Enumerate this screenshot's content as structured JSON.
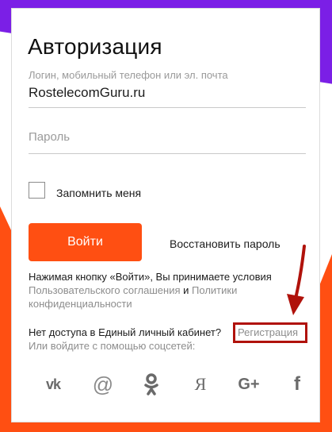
{
  "title": "Авторизация",
  "login": {
    "label": "Логин, мобильный телефон или эл. почта",
    "value": "RostelecomGuru.ru"
  },
  "password": {
    "placeholder": "Пароль"
  },
  "remember": {
    "label": "Запомнить меня",
    "checked": false
  },
  "login_button": "Войти",
  "restore_link": "Восстановить пароль",
  "terms": {
    "text": "Нажимая кнопку «Войти», Вы принимаете условия",
    "agreement_link": "Пользовательского соглашения",
    "and": "и",
    "policy_link": "Политики конфиденциальности"
  },
  "no_access": {
    "text": "Нет доступа в Единый личный кабинет?",
    "register_link": "Регистрация"
  },
  "social": {
    "label": "Или войдите с помощью соцсетей:",
    "icons": [
      "vk-icon",
      "mail-icon",
      "odnoklassniki-icon",
      "yandex-icon",
      "google-plus-icon",
      "facebook-icon"
    ],
    "vk_text": "vk",
    "mail_text": "@",
    "yandex_text": "Я",
    "google_text": "G+",
    "facebook_text": "f"
  },
  "colors": {
    "accent": "#ff4f12",
    "purple": "#7b1fe6",
    "highlight": "#b0120b"
  }
}
